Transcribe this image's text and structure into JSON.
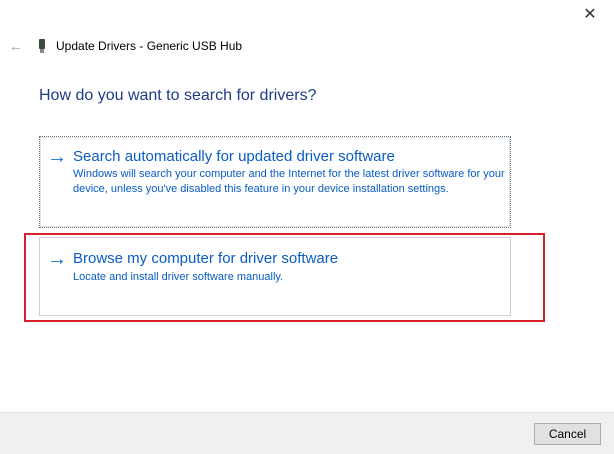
{
  "window": {
    "title": "Update Drivers - Generic USB Hub",
    "close_glyph": "✕",
    "back_glyph": "←"
  },
  "main": {
    "heading": "How do you want to search for drivers?",
    "options": [
      {
        "arrow_glyph": "→",
        "title": "Search automatically for updated driver software",
        "description": "Windows will search your computer and the Internet for the latest driver software for your device, unless you've disabled this feature in your device installation settings."
      },
      {
        "arrow_glyph": "→",
        "title": "Browse my computer for driver software",
        "description": "Locate and install driver software manually."
      }
    ]
  },
  "footer": {
    "cancel_label": "Cancel"
  },
  "colors": {
    "heading": "#1e3b87",
    "link": "#0a5cc2",
    "arrow": "#1570d4",
    "highlight": "#d6202a",
    "footer_bg": "#f0f0f0"
  },
  "icons": {
    "device": "usb-device-icon",
    "back": "back-arrow-icon",
    "close": "close-icon",
    "option_arrow": "right-arrow-icon"
  }
}
